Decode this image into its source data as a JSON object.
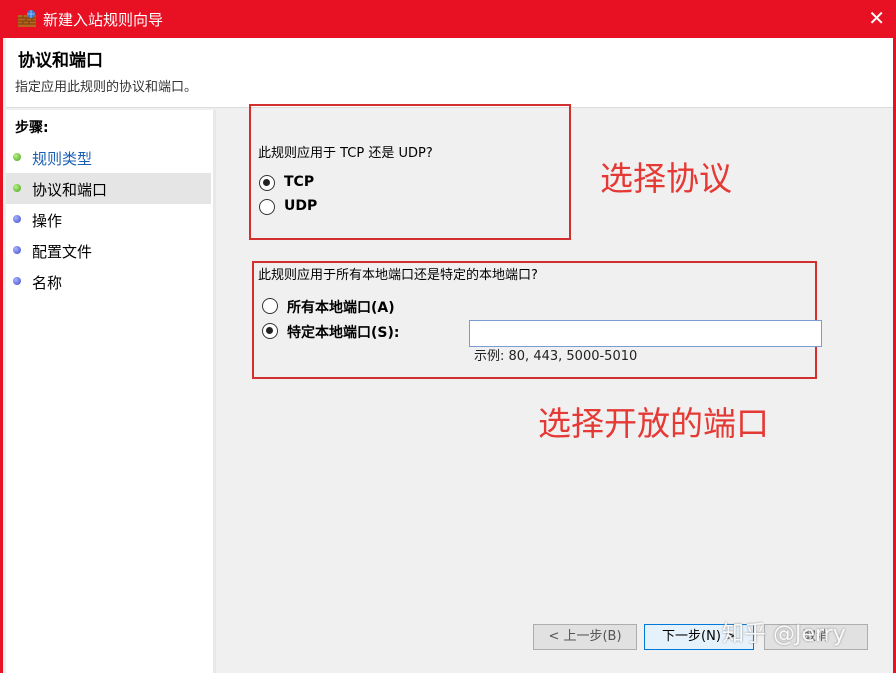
{
  "window": {
    "title": "新建入站规则向导",
    "close_glyph": "✕"
  },
  "header": {
    "title": "协议和端口",
    "subtitle": "指定应用此规则的协议和端口。"
  },
  "sidebar": {
    "steps_label": "步骤:",
    "items": [
      {
        "label": "规则类型",
        "dot": "green"
      },
      {
        "label": "协议和端口",
        "dot": "green"
      },
      {
        "label": "操作",
        "dot": "blue"
      },
      {
        "label": "配置文件",
        "dot": "blue"
      },
      {
        "label": "名称",
        "dot": "blue"
      }
    ]
  },
  "protocol": {
    "question": "此规则应用于 TCP 还是 UDP?",
    "options": [
      {
        "label": "TCP",
        "checked": true
      },
      {
        "label": "UDP",
        "checked": false
      }
    ]
  },
  "ports": {
    "question": "此规则应用于所有本地端口还是特定的本地端口?",
    "options": [
      {
        "label": "所有本地端口(A)",
        "checked": false
      },
      {
        "label": "特定本地端口(S):",
        "checked": true
      }
    ],
    "input_value": "",
    "example": "示例: 80, 443, 5000-5010"
  },
  "annotations": {
    "protocol": "选择协议",
    "ports": "选择开放的端口"
  },
  "buttons": {
    "back": "< 上一步(B)",
    "next": "下一步(N) >",
    "cancel": "取消"
  },
  "watermark": "知乎 @Jerry",
  "colors": {
    "titlebar": "#e81123",
    "annotation": "#e53935",
    "link": "#1a5fb4"
  }
}
